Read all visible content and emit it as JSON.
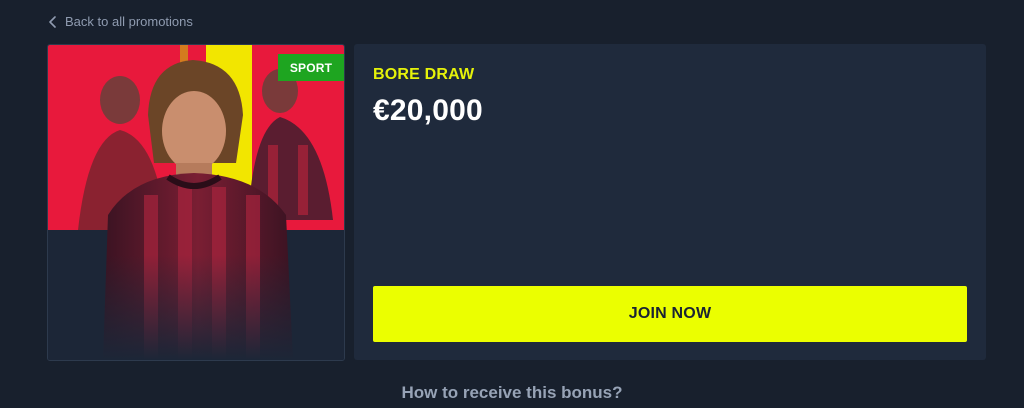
{
  "navigation": {
    "back_label": "Back to all promotions"
  },
  "promotion": {
    "category_tag": "SPORT",
    "title": "BORE DRAW",
    "amount": "€20,000",
    "cta_label": "JOIN NOW"
  },
  "section": {
    "how_to_heading": "How to receive this bonus?"
  },
  "colors": {
    "background": "#18202d",
    "panel": "#1f2a3c",
    "accent_yellow": "#ebff00",
    "title_yellow": "#e5f20a",
    "tag_green": "#1ea520",
    "art_red": "#e8193c"
  },
  "icons": {
    "back": "chevron-left-icon"
  }
}
